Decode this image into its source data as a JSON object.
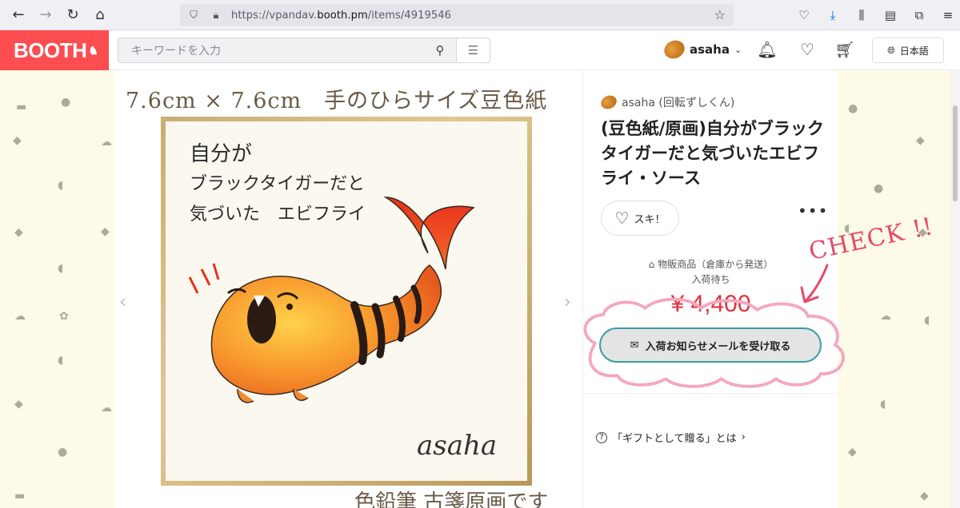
{
  "browser": {
    "url_prefix": "https://vpandav.",
    "url_domain": "booth.pm",
    "url_path": "/items/4919546"
  },
  "header": {
    "logo": "BOOTH",
    "search_placeholder": "キーワードを入力",
    "username": "asaha",
    "language": "日本語"
  },
  "gallery": {
    "top_caption": "7.6cm × 7.6cm　手のひらサイズ豆色紙",
    "art_lines": [
      "自分が",
      "ブラックタイガーだと",
      "気づいた　エビフライ"
    ],
    "signature": "asaha",
    "bottom_caption": "色鉛筆 古箋原画です"
  },
  "item": {
    "shop": "asaha (回転ずしくん)",
    "title": "(豆色紙/原画)自分がブラックタイガーだと気づいたエビフライ・ソース",
    "like_label": "スキ！",
    "shipping": "物販商品（倉庫から発送）",
    "stock_status": "入荷待ち",
    "price": "¥ 4,400",
    "notify_button": "入荷お知らせメールを受け取る",
    "gift_link": "「ギフトとして贈る」とは"
  },
  "annotation": {
    "check_text": "CHECK !!",
    "accent_color": "#e8486a"
  },
  "colors": {
    "brand": "#fc4d50",
    "price": "#e0323b",
    "button_border": "#3a9aa8"
  }
}
